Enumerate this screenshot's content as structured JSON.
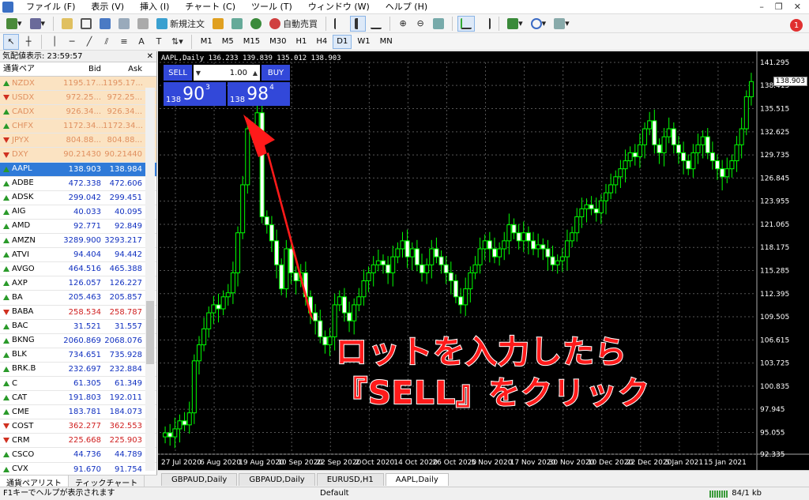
{
  "menu": [
    "ファイル (F)",
    "表示 (V)",
    "挿入 (I)",
    "チャート (C)",
    "ツール (T)",
    "ウィンドウ (W)",
    "ヘルプ (H)"
  ],
  "toolbar": {
    "new_order": "新規注文",
    "auto_trade": "自動売買",
    "timeframes": [
      "M1",
      "M5",
      "M15",
      "M30",
      "H1",
      "H4",
      "D1",
      "W1",
      "MN"
    ],
    "selected_timeframe": "D1",
    "notification_count": "1"
  },
  "market_watch": {
    "title": "気配値表示: 23:59:57",
    "headers": {
      "symbol": "通貨ペア",
      "bid": "Bid",
      "ask": "Ask"
    },
    "rows": [
      {
        "s": "NZDX",
        "b": "1195.17...",
        "a": "1195.17...",
        "d": "up",
        "fx": true
      },
      {
        "s": "USDX",
        "b": "972.25...",
        "a": "972.25...",
        "d": "dn",
        "fx": true
      },
      {
        "s": "CADX",
        "b": "926.34...",
        "a": "926.34...",
        "d": "up",
        "fx": true
      },
      {
        "s": "CHFX",
        "b": "1172.34...",
        "a": "1172.34...",
        "d": "up",
        "fx": true
      },
      {
        "s": "JPYX",
        "b": "804.88...",
        "a": "804.88...",
        "d": "dn",
        "fx": true
      },
      {
        "s": "DXY",
        "b": "90.21430",
        "a": "90.21440",
        "d": "dn",
        "fx": true
      },
      {
        "s": "AAPL",
        "b": "138.903",
        "a": "138.984",
        "d": "up",
        "sel": true
      },
      {
        "s": "ADBE",
        "b": "472.338",
        "a": "472.606",
        "d": "up"
      },
      {
        "s": "ADSK",
        "b": "299.042",
        "a": "299.451",
        "d": "up"
      },
      {
        "s": "AIG",
        "b": "40.033",
        "a": "40.095",
        "d": "up"
      },
      {
        "s": "AMD",
        "b": "92.771",
        "a": "92.849",
        "d": "up"
      },
      {
        "s": "AMZN",
        "b": "3289.900",
        "a": "3293.217",
        "d": "up"
      },
      {
        "s": "ATVI",
        "b": "94.404",
        "a": "94.442",
        "d": "up"
      },
      {
        "s": "AVGO",
        "b": "464.516",
        "a": "465.388",
        "d": "up"
      },
      {
        "s": "AXP",
        "b": "126.057",
        "a": "126.227",
        "d": "up"
      },
      {
        "s": "BA",
        "b": "205.463",
        "a": "205.857",
        "d": "up"
      },
      {
        "s": "BABA",
        "b": "258.534",
        "a": "258.787",
        "d": "dn",
        "red": true
      },
      {
        "s": "BAC",
        "b": "31.521",
        "a": "31.557",
        "d": "up"
      },
      {
        "s": "BKNG",
        "b": "2060.869",
        "a": "2068.076",
        "d": "up"
      },
      {
        "s": "BLK",
        "b": "734.651",
        "a": "735.928",
        "d": "up"
      },
      {
        "s": "BRK.B",
        "b": "232.697",
        "a": "232.884",
        "d": "up"
      },
      {
        "s": "C",
        "b": "61.305",
        "a": "61.349",
        "d": "up"
      },
      {
        "s": "CAT",
        "b": "191.803",
        "a": "192.011",
        "d": "up"
      },
      {
        "s": "CME",
        "b": "183.781",
        "a": "184.073",
        "d": "up"
      },
      {
        "s": "COST",
        "b": "362.277",
        "a": "362.553",
        "d": "dn",
        "red": true
      },
      {
        "s": "CRM",
        "b": "225.668",
        "a": "225.903",
        "d": "dn",
        "red": true
      },
      {
        "s": "CSCO",
        "b": "44.736",
        "a": "44.789",
        "d": "up"
      },
      {
        "s": "CVX",
        "b": "91.670",
        "a": "91.754",
        "d": "up"
      }
    ],
    "tabs": [
      "通貨ペアリスト",
      "ティックチャート"
    ]
  },
  "chart": {
    "title": "AAPL,Daily  136.233 139.839 135.012 138.903",
    "current_price": "138.903",
    "one_click": {
      "sell_label": "SELL",
      "buy_label": "BUY",
      "lot": "1.00",
      "sell_prefix": "138",
      "sell_big": "90",
      "sell_sup": "3",
      "buy_prefix": "138",
      "buy_big": "98",
      "buy_sup": "4"
    },
    "annotation_line1": "ロットを入力したら",
    "annotation_line2": "『SELL』をクリック",
    "arrow_color": "#ff1a1a"
  },
  "chart_data": {
    "type": "candlestick",
    "title": "AAPL,Daily",
    "y_ticks": [
      "141.295",
      "138.415",
      "135.515",
      "132.625",
      "129.735",
      "126.845",
      "123.955",
      "121.065",
      "118.175",
      "115.285",
      "112.395",
      "109.505",
      "106.615",
      "103.725",
      "100.835",
      "97.945",
      "95.055",
      "92.335"
    ],
    "x_ticks": [
      "27 Jul 2020",
      "6 Aug 2020",
      "19 Aug 2020",
      "10 Sep 2020",
      "22 Sep 2020",
      "2 Oct 2020",
      "14 Oct 2020",
      "26 Oct 2020",
      "5 Nov 2020",
      "17 Nov 2020",
      "30 Nov 2020",
      "10 Dec 2020",
      "22 Dec 2020",
      "5 Jan 2021",
      "15 Jan 2021"
    ],
    "ylim": [
      92.335,
      141.295
    ],
    "grid": true,
    "candle_color": "#00ff00",
    "closes": [
      95.0,
      94.5,
      95.5,
      96.5,
      96.0,
      97.5,
      104,
      106,
      108,
      110,
      111,
      110.5,
      112,
      112.5,
      115,
      120,
      126,
      133,
      133,
      135,
      122,
      121,
      119,
      116,
      113,
      118,
      115,
      114,
      115,
      112,
      110,
      109,
      107,
      106,
      107,
      111,
      112,
      110,
      109,
      111,
      112,
      114,
      115,
      116,
      116.5,
      116,
      115,
      117,
      118,
      119,
      117,
      118,
      116,
      115,
      116,
      118,
      117,
      116,
      115,
      114,
      112,
      111,
      113,
      115,
      116,
      118,
      119,
      118,
      117,
      118,
      119,
      121,
      120,
      119,
      120,
      119,
      118,
      118.5,
      118,
      117,
      116,
      116.5,
      117,
      119,
      120,
      122,
      123,
      123.5,
      123,
      122.5,
      124,
      125,
      126,
      127,
      128,
      129,
      130,
      129.5,
      131,
      133,
      134,
      131,
      130,
      132,
      133,
      131,
      130,
      129,
      128,
      130,
      131,
      132,
      130,
      129,
      128,
      127,
      128,
      129,
      131,
      133,
      137,
      138.9
    ]
  },
  "chart_tabs": [
    "GBPAUD,Daily",
    "GBPAUD,Daily",
    "EURUSD,H1",
    "AAPL,Daily"
  ],
  "active_chart_tab": "AAPL,Daily",
  "status": {
    "help": "F1キーでヘルプが表示されます",
    "profile": "Default",
    "traffic": "84/1 kb"
  }
}
